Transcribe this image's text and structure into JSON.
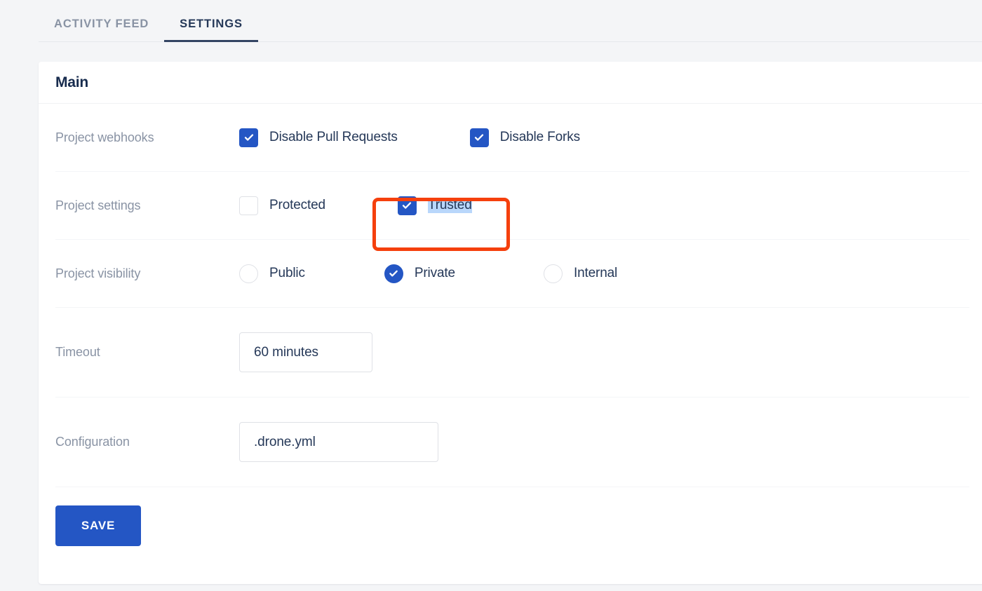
{
  "tabs": [
    {
      "label": "ACTIVITY FEED",
      "active": false
    },
    {
      "label": "SETTINGS",
      "active": true
    }
  ],
  "card": {
    "title": "Main"
  },
  "rows": {
    "webhooks": {
      "label": "Project webhooks",
      "options": [
        {
          "label": "Disable Pull Requests",
          "checked": true
        },
        {
          "label": "Disable Forks",
          "checked": true
        }
      ]
    },
    "settings": {
      "label": "Project settings",
      "options": [
        {
          "label": "Protected",
          "checked": false,
          "selected": false
        },
        {
          "label": "Trusted",
          "checked": true,
          "selected": true
        }
      ]
    },
    "visibility": {
      "label": "Project visibility",
      "options": [
        {
          "label": "Public",
          "checked": false
        },
        {
          "label": "Private",
          "checked": true
        },
        {
          "label": "Internal",
          "checked": false
        }
      ]
    },
    "timeout": {
      "label": "Timeout",
      "value": "60 minutes",
      "placeholder": "60 minutes"
    },
    "configuration": {
      "label": "Configuration",
      "value": ".drone.yml",
      "placeholder": ".drone.yml"
    }
  },
  "actions": {
    "save_label": "SAVE"
  },
  "colors": {
    "accent": "#2456c4",
    "annotation": "#f5400d",
    "selection": "#b9d7fb",
    "tab_active": "#253858",
    "tab_inactive": "#8993a4",
    "label": "#8993a4",
    "page_bg": "#f4f5f7"
  }
}
